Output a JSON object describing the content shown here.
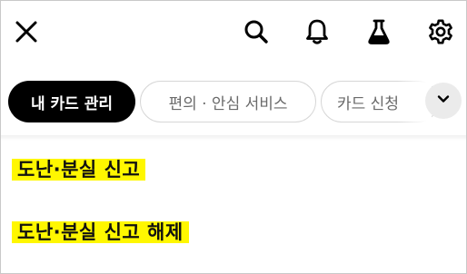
{
  "header": {
    "close_icon": "close-icon",
    "search_icon": "search-icon",
    "notification_icon": "bell-icon",
    "lab_icon": "flask-icon",
    "settings_icon": "gear-icon"
  },
  "tabs": [
    {
      "label": "내 카드 관리",
      "active": true
    },
    {
      "label": "편의 · 안심 서비스",
      "active": false
    },
    {
      "label": "카드 신청",
      "active": false
    }
  ],
  "tabs_more_icon": "chevron-down-icon",
  "menu": [
    {
      "label": "도난·분실 신고"
    },
    {
      "label": "도난·분실 신고 해제"
    }
  ],
  "colors": {
    "highlight": "#fff700",
    "active_chip_bg": "#000000",
    "chip_border": "#d6d6d6"
  }
}
